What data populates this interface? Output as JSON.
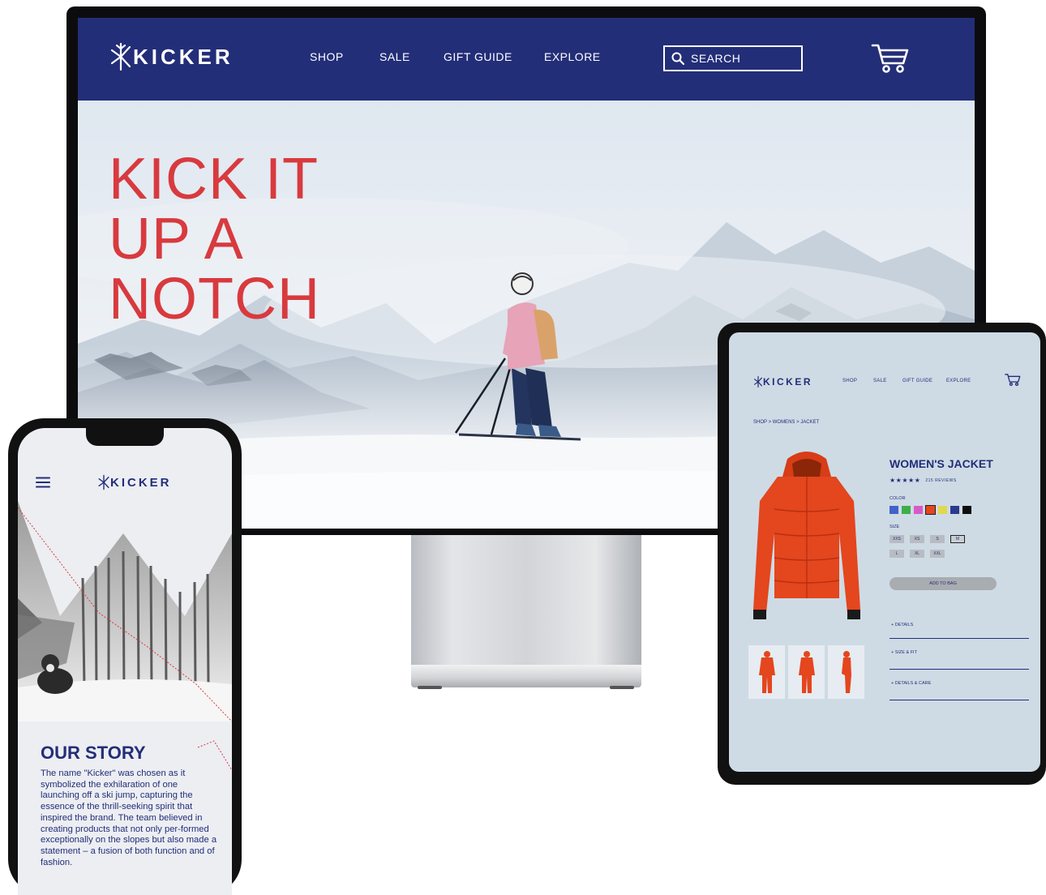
{
  "desktop": {
    "logo": "KICKER",
    "nav": [
      "SHOP",
      "SALE",
      "GIFT GUIDE",
      "EXPLORE"
    ],
    "search_label": "SEARCH",
    "hero_title": "KICK IT\nUP A\nNOTCH"
  },
  "phone": {
    "logo": "KICKER",
    "story_title": "OUR STORY",
    "story_body": "The name \"Kicker\" was chosen as it symbolized the exhilaration of one launching off a ski jump, capturing the essence of the thrill-seeking spirit that inspired the brand. The team believed in creating products that not only per-formed exceptionally on the slopes but also made a statement – a fusion of both function and of fashion."
  },
  "tablet": {
    "logo": "KICKER",
    "nav": [
      "SHOP",
      "SALE",
      "GIFT GUIDE",
      "EXPLORE"
    ],
    "breadcrumb": "SHOP > WOMENS > JACKET",
    "product_title": "WOMEN'S JACKET",
    "stars": "★★★★★",
    "reviews": "215 REVIEWS",
    "color_label": "COLOR",
    "colors": [
      "#3f63c8",
      "#3fae4a",
      "#d859c8",
      "#e4461e",
      "#e2d84c",
      "#2a3a8c",
      "#0d0d0d"
    ],
    "selected_color_index": 3,
    "size_label": "SIZE",
    "sizes_row1": [
      "XXS",
      "XS",
      "S",
      "M"
    ],
    "sizes_row2": [
      "L",
      "XL",
      "XXL"
    ],
    "selected_size": "M",
    "add_to_bag": "ADD TO BAG",
    "accordion": [
      "+ DETAILS",
      "+ SIZE & FIT",
      "+ DETAILS & CARE"
    ]
  },
  "colors": {
    "brand_navy": "#232e78",
    "hero_red": "#d83a3e",
    "jacket_orange": "#e4461e"
  }
}
